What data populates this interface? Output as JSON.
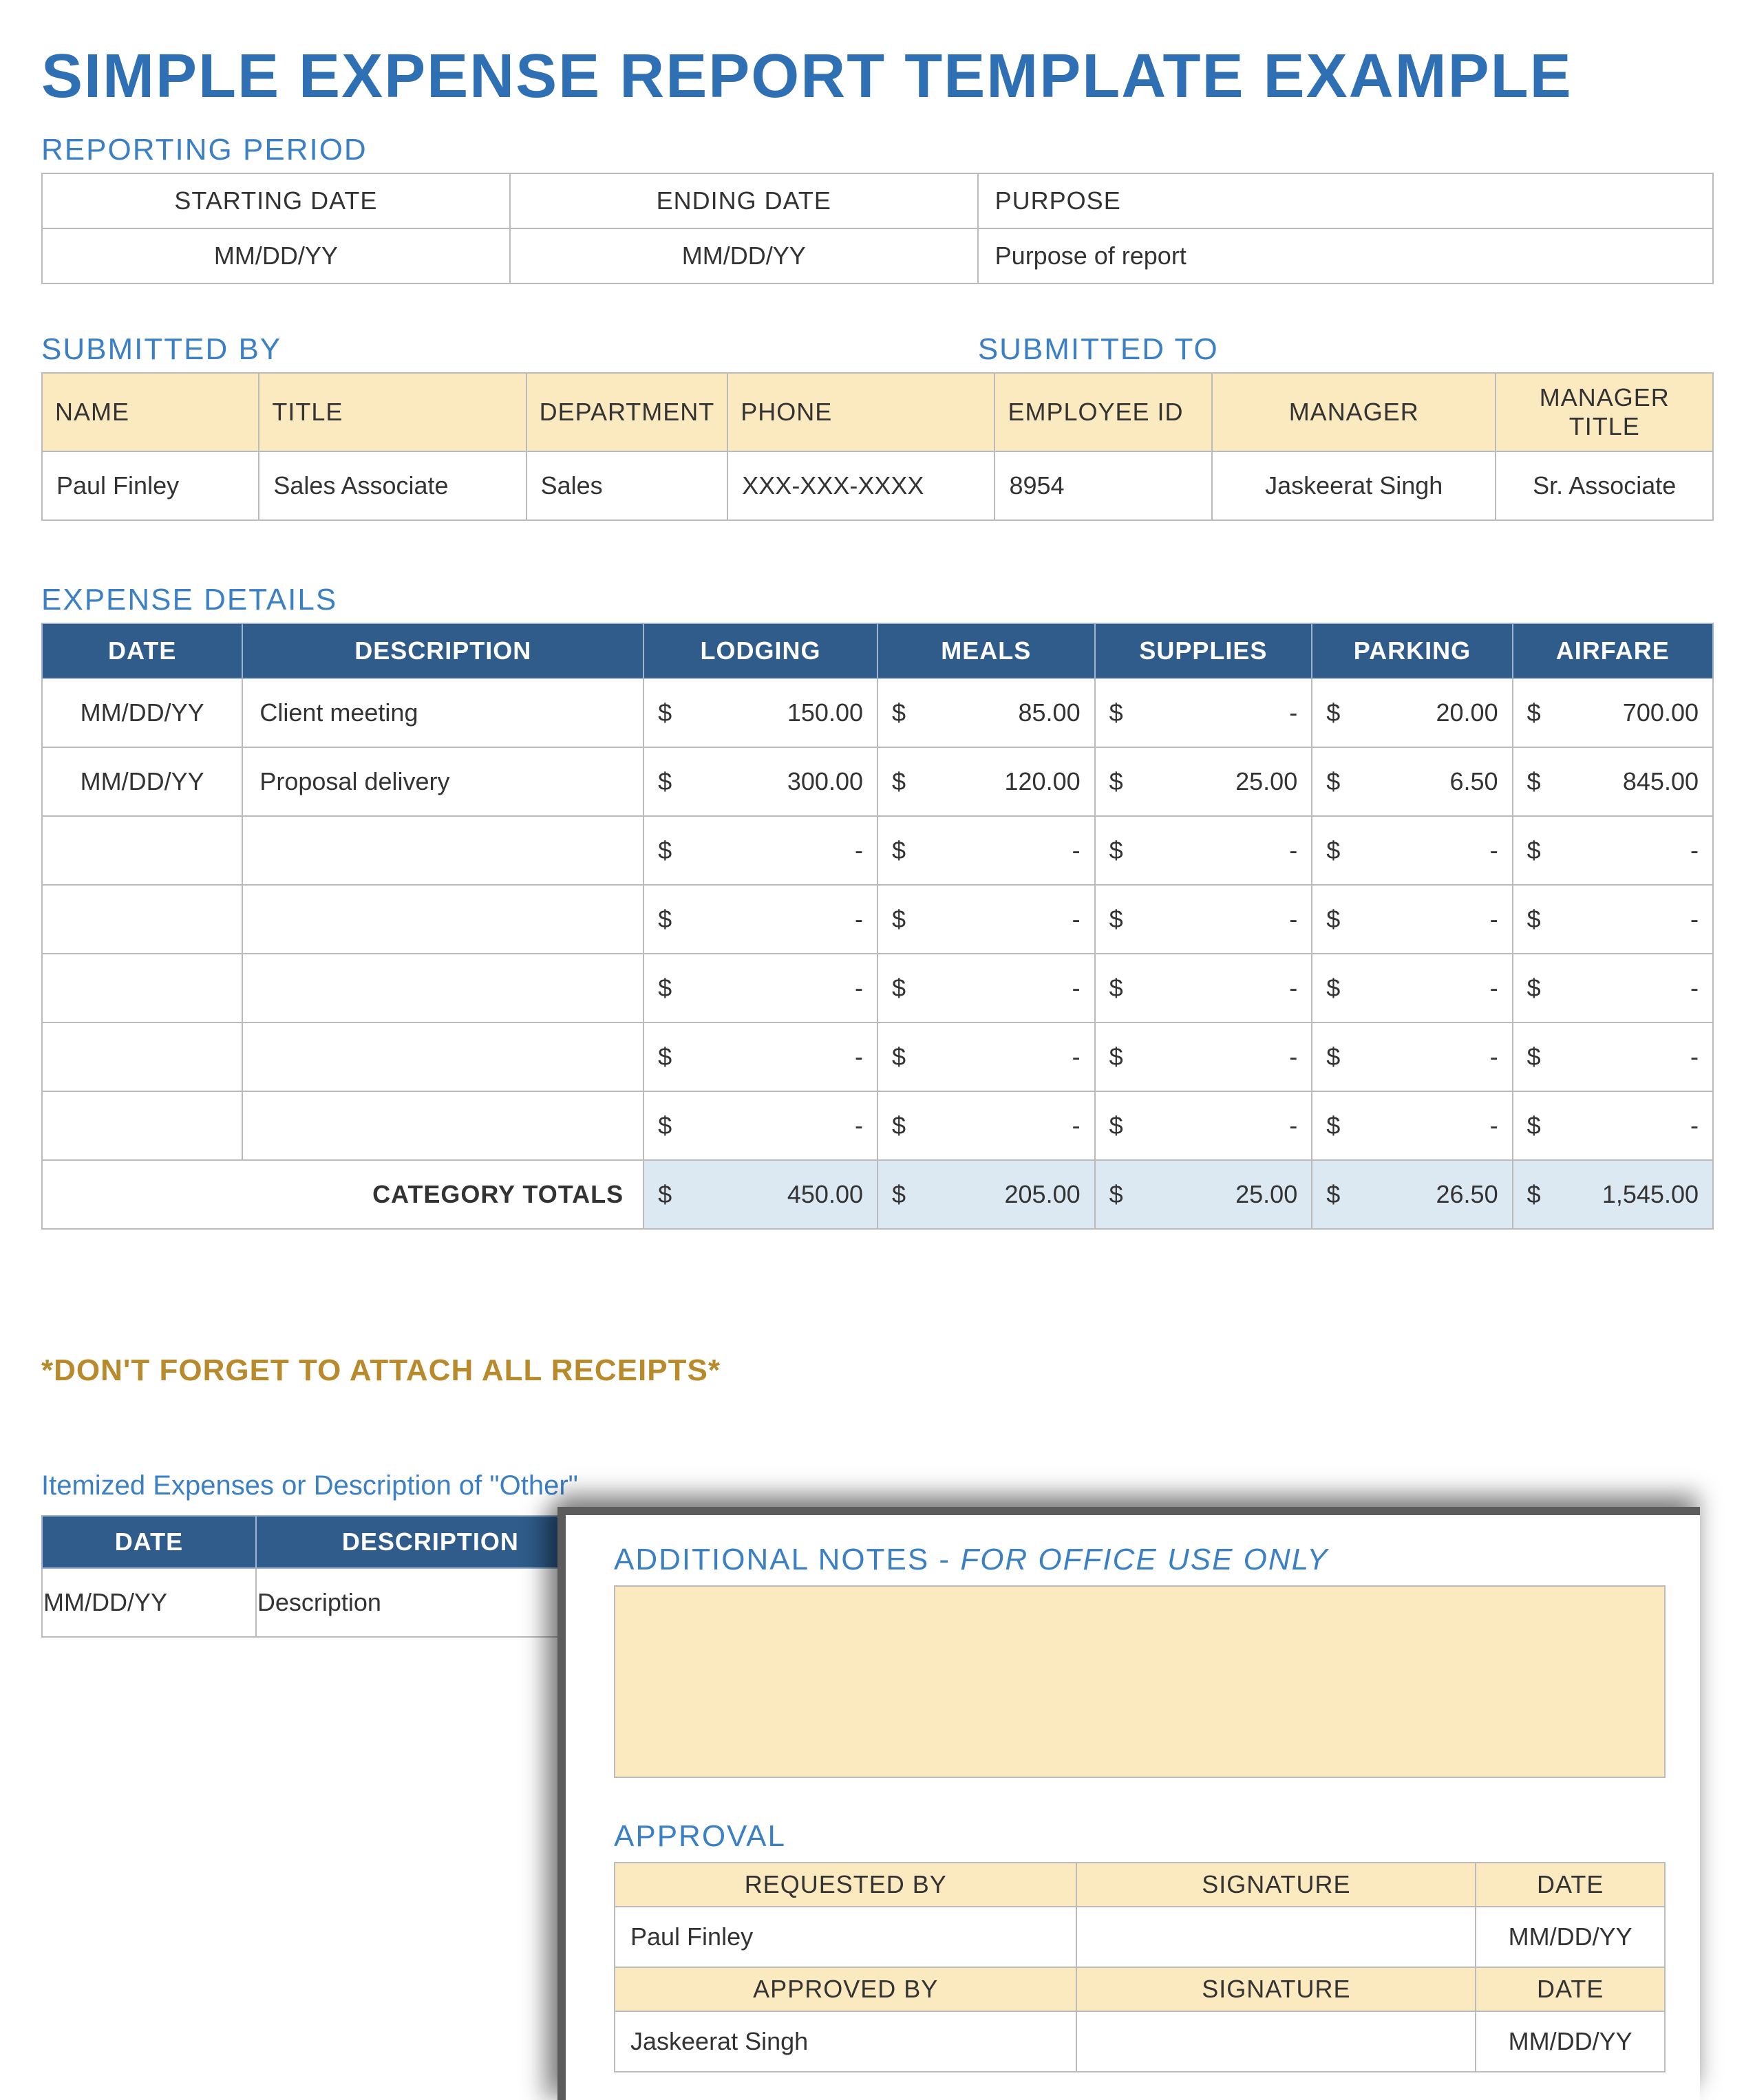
{
  "title": "SIMPLE EXPENSE REPORT TEMPLATE EXAMPLE",
  "reporting": {
    "label": "REPORTING PERIOD",
    "headers": {
      "start": "STARTING DATE",
      "end": "ENDING DATE",
      "purpose": "PURPOSE"
    },
    "values": {
      "start": "MM/DD/YY",
      "end": "MM/DD/YY",
      "purpose": "Purpose of report"
    }
  },
  "submitted": {
    "by_label": "SUBMITTED BY",
    "to_label": "SUBMITTED TO",
    "headers": [
      "NAME",
      "TITLE",
      "DEPARTMENT",
      "PHONE",
      "EMPLOYEE ID",
      "MANAGER",
      "MANAGER TITLE"
    ],
    "values": [
      "Paul Finley",
      "Sales Associate",
      "Sales",
      "XXX-XXX-XXXX",
      "8954",
      "Jaskeerat Singh",
      "Sr. Associate"
    ]
  },
  "expense": {
    "label": "EXPENSE DETAILS",
    "headers": [
      "DATE",
      "DESCRIPTION",
      "LODGING",
      "MEALS",
      "SUPPLIES",
      "PARKING",
      "AIRFARE"
    ],
    "rows": [
      {
        "date": "MM/DD/YY",
        "desc": "Client meeting",
        "lodging": "150.00",
        "meals": "85.00",
        "supplies": "-",
        "parking": "20.00",
        "airfare": "700.00"
      },
      {
        "date": "MM/DD/YY",
        "desc": "Proposal delivery",
        "lodging": "300.00",
        "meals": "120.00",
        "supplies": "25.00",
        "parking": "6.50",
        "airfare": "845.00"
      },
      {
        "date": "",
        "desc": "",
        "lodging": "-",
        "meals": "-",
        "supplies": "-",
        "parking": "-",
        "airfare": "-"
      },
      {
        "date": "",
        "desc": "",
        "lodging": "-",
        "meals": "-",
        "supplies": "-",
        "parking": "-",
        "airfare": "-"
      },
      {
        "date": "",
        "desc": "",
        "lodging": "-",
        "meals": "-",
        "supplies": "-",
        "parking": "-",
        "airfare": "-"
      },
      {
        "date": "",
        "desc": "",
        "lodging": "-",
        "meals": "-",
        "supplies": "-",
        "parking": "-",
        "airfare": "-"
      },
      {
        "date": "",
        "desc": "",
        "lodging": "-",
        "meals": "-",
        "supplies": "-",
        "parking": "-",
        "airfare": "-"
      }
    ],
    "totals_label": "CATEGORY TOTALS",
    "totals": {
      "lodging": "450.00",
      "meals": "205.00",
      "supplies": "25.00",
      "parking": "26.50",
      "airfare": "1,545.00"
    }
  },
  "receipts_note": "*DON'T FORGET TO ATTACH ALL RECEIPTS*",
  "itemized": {
    "label": "Itemized Expenses or Description of \"Other\"",
    "headers": [
      "DATE",
      "DESCRIPTION"
    ],
    "row": {
      "date": "MM/DD/YY",
      "desc": "Description"
    }
  },
  "overlay": {
    "notes_label_a": "ADDITIONAL NOTES - ",
    "notes_label_b": "FOR OFFICE USE ONLY",
    "approval_label": "APPROVAL",
    "h1": [
      "REQUESTED BY",
      "SIGNATURE",
      "DATE"
    ],
    "r1": [
      "Paul Finley",
      "",
      "MM/DD/YY"
    ],
    "h2": [
      "APPROVED BY",
      "SIGNATURE",
      "DATE"
    ],
    "r2": [
      "Jaskeerat Singh",
      "",
      "MM/DD/YY"
    ]
  },
  "currency_symbol": "$"
}
